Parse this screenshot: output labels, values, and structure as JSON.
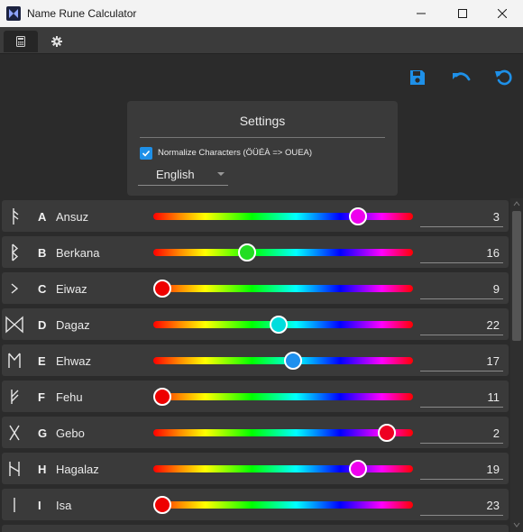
{
  "window": {
    "title": "Name Rune Calculator",
    "icon": "app-logo-icon"
  },
  "tabs": [
    {
      "icon": "calculator-icon",
      "active": true
    },
    {
      "icon": "gear-icon",
      "active": false
    }
  ],
  "toolbar": {
    "accent_color": "#1e90e8",
    "buttons": [
      {
        "icon": "save-icon"
      },
      {
        "icon": "undo-icon"
      },
      {
        "icon": "reset-icon"
      }
    ]
  },
  "settings": {
    "title": "Settings",
    "normalize_checked": true,
    "normalize_label": "Normalize Characters (ÖÜÉÀ => OUEA)",
    "language": "English"
  },
  "runes": [
    {
      "letter": "A",
      "name": "Ansuz",
      "value": "3",
      "slider_fraction": 0.81,
      "thumb_color": "#ee00ee"
    },
    {
      "letter": "B",
      "name": "Berkana",
      "value": "16",
      "slider_fraction": 0.35,
      "thumb_color": "#22dd22"
    },
    {
      "letter": "C",
      "name": "Eiwaz",
      "value": "9",
      "slider_fraction": 0.0,
      "thumb_color": "#ee0000"
    },
    {
      "letter": "D",
      "name": "Dagaz",
      "value": "22",
      "slider_fraction": 0.48,
      "thumb_color": "#00dddd"
    },
    {
      "letter": "E",
      "name": "Ehwaz",
      "value": "17",
      "slider_fraction": 0.54,
      "thumb_color": "#1e90ee"
    },
    {
      "letter": "F",
      "name": "Fehu",
      "value": "11",
      "slider_fraction": 0.0,
      "thumb_color": "#ee0000"
    },
    {
      "letter": "G",
      "name": "Gebo",
      "value": "2",
      "slider_fraction": 0.93,
      "thumb_color": "#ee0022"
    },
    {
      "letter": "H",
      "name": "Hagalaz",
      "value": "19",
      "slider_fraction": 0.81,
      "thumb_color": "#ee00ee"
    },
    {
      "letter": "I",
      "name": "Isa",
      "value": "23",
      "slider_fraction": 0.0,
      "thumb_color": "#ee0000"
    }
  ]
}
